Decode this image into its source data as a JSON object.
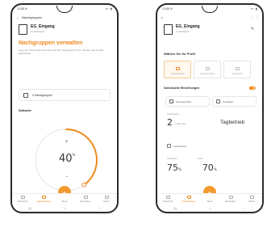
{
  "left_screen": {
    "status": {
      "time": "13:58 ✉",
      "icons": "▾ ⌁ ▮"
    },
    "appbar": {
      "back": "←",
      "title": "Nachtgruppen"
    },
    "device": {
      "name": "EG_Eingang",
      "sub": "1 Heizkörper"
    },
    "title": "Nachgruppen verwalten",
    "description": "Lege die Thermostat und Leiter fest der Nachgruppe hinzu. Steuere alle Geräte gleichzeitig.",
    "group_count": "0 Nachtgruppen",
    "section": "Sollwert",
    "dial": {
      "value": "40",
      "unit": "%",
      "plus": "+",
      "minus": "−",
      "fill": 0.4
    },
    "nav": [
      "Übersicht",
      "Nachtgruppe",
      "Mehr",
      "Einstellen",
      "Menü"
    ],
    "fab": "+",
    "sysnav": [
      "|||",
      "○",
      "‹"
    ]
  },
  "right_screen": {
    "status": {
      "time": "13:58 ✉",
      "icons": "▾ ⌁ ▮"
    },
    "appbar": {
      "close": "×",
      "dots": "⋮  ⋮"
    },
    "device": {
      "name": "EG_Eingang",
      "sub": "1 Heizkörper"
    },
    "edit_icon": "✎",
    "profile_label": "Wählen Sie Ihr Profil",
    "profiles": [
      "Individuell aktiv",
      "Konstante Nacht",
      "Nachtprofil"
    ],
    "settings_label": "Individuelle Einstellungen",
    "tiles": [
      "Stromspeicher",
      "Umstellen"
    ],
    "value_two_label": "Geräteanzahl",
    "value_two": "2",
    "value_two_sub": "Geräte aktiv",
    "mode": "Tagbetrieb",
    "check_label": "Fensterkont.",
    "bottom_label_a": "Temperatur",
    "bottom_value_a": "75",
    "bottom_unit_a": "%",
    "bottom_label_b": "Ventil",
    "bottom_value_b": "70",
    "bottom_unit_b": "%",
    "nav": [
      "Übersicht",
      "Nachtgruppe",
      "Mehr",
      "Einstellen",
      "Menü"
    ],
    "fab": "+",
    "sysnav": [
      "|||",
      "○",
      "‹"
    ]
  },
  "colors": {
    "accent": "#ef8a1f",
    "text": "#222222"
  }
}
